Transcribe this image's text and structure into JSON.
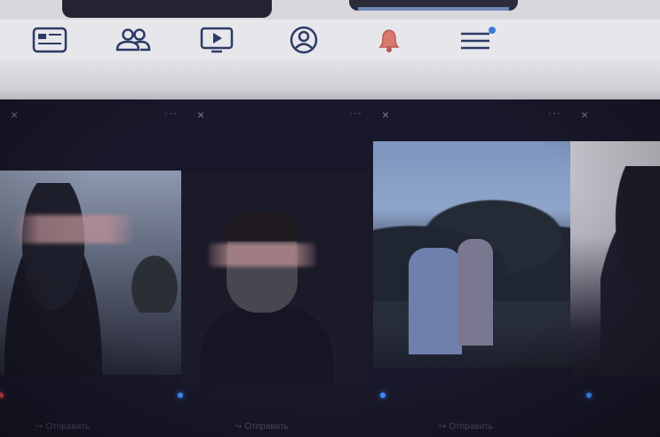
{
  "navbar": {
    "items": [
      {
        "icon": "feed-icon",
        "name": "nav-feed"
      },
      {
        "icon": "friends-icon",
        "name": "nav-friends"
      },
      {
        "icon": "video-icon",
        "name": "nav-watch"
      },
      {
        "icon": "profile-icon",
        "name": "nav-profile"
      },
      {
        "icon": "bell-icon",
        "name": "nav-notifications"
      },
      {
        "icon": "menu-icon",
        "name": "nav-menu"
      }
    ],
    "colors": {
      "icon": "#2c3a66",
      "bell": "#d9786f",
      "badge": "#3f78d6"
    }
  },
  "stories": {
    "close_glyph": "×",
    "more_glyph": "···",
    "share_label": "Отправить",
    "cards": [
      {
        "has_dot": true,
        "dot_color": "red"
      },
      {
        "has_dot": true,
        "dot_color": "blue"
      },
      {
        "has_dot": true,
        "dot_color": "blue"
      },
      {
        "has_dot": true,
        "dot_color": "blue"
      }
    ]
  }
}
